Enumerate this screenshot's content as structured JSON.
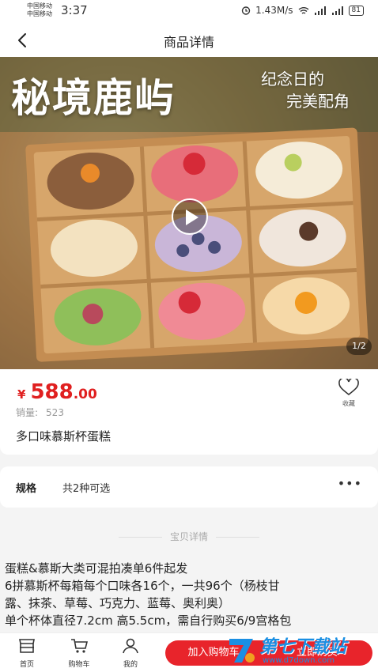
{
  "status_bar": {
    "carrier_1": "中国移动",
    "carrier_2": "中国移动",
    "time": "3:37",
    "network_speed": "1.43M/s",
    "battery": "81"
  },
  "nav": {
    "title": "商品详情",
    "back_icon": "chevron-left-icon"
  },
  "hero": {
    "title": "秘境鹿屿",
    "subtitle_1": "纪念日的",
    "subtitle_2": "完美配角",
    "page_indicator": "1/2",
    "play_icon": "play-icon"
  },
  "product": {
    "currency": "¥",
    "price_int": "588",
    "price_dec": ".00",
    "favorite_label": "收藏",
    "sales_label": "销量:",
    "sales_value": "523",
    "title": "多口味慕斯杯蛋糕"
  },
  "spec": {
    "label": "规格",
    "value": "共2种可选",
    "more": "•••"
  },
  "detail": {
    "heading": "宝贝详情",
    "lines": [
      "蛋糕&慕斯大类可混拍凑单6件起发",
      "6拼慕斯杯每箱每个口味各16个，一共96个（杨枝甘",
      "露、抹茶、草莓、巧克力、蓝莓、奥利奥）",
      "单个杯体直径7.2cm 高5.5cm，需自行购买6/9宫格包"
    ]
  },
  "bottom_bar": {
    "home_label": "首页",
    "cart_label": "购物车",
    "mine_label": "我的",
    "add_to_cart": "加入购物车",
    "buy_now": "立即购买"
  },
  "watermark": {
    "text": "第七下载站",
    "url": "www.d7down.com"
  },
  "colors": {
    "accent": "#e8242b",
    "price": "#e02020",
    "watermark": "#1a8fe3"
  }
}
